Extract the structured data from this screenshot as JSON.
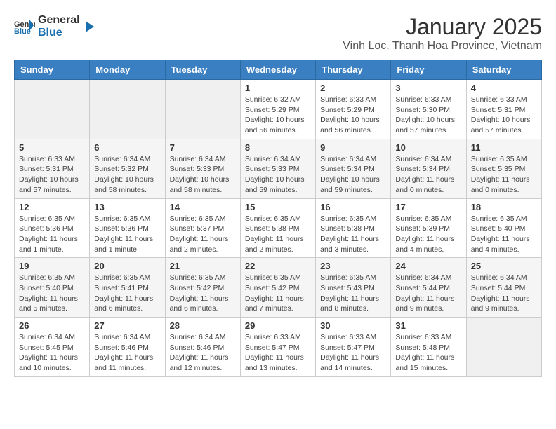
{
  "header": {
    "logo_general": "General",
    "logo_blue": "Blue",
    "month_title": "January 2025",
    "subtitle": "Vinh Loc, Thanh Hoa Province, Vietnam"
  },
  "weekdays": [
    "Sunday",
    "Monday",
    "Tuesday",
    "Wednesday",
    "Thursday",
    "Friday",
    "Saturday"
  ],
  "weeks": [
    [
      {
        "day": "",
        "info": ""
      },
      {
        "day": "",
        "info": ""
      },
      {
        "day": "",
        "info": ""
      },
      {
        "day": "1",
        "info": "Sunrise: 6:32 AM\nSunset: 5:29 PM\nDaylight: 10 hours and 56 minutes."
      },
      {
        "day": "2",
        "info": "Sunrise: 6:33 AM\nSunset: 5:29 PM\nDaylight: 10 hours and 56 minutes."
      },
      {
        "day": "3",
        "info": "Sunrise: 6:33 AM\nSunset: 5:30 PM\nDaylight: 10 hours and 57 minutes."
      },
      {
        "day": "4",
        "info": "Sunrise: 6:33 AM\nSunset: 5:31 PM\nDaylight: 10 hours and 57 minutes."
      }
    ],
    [
      {
        "day": "5",
        "info": "Sunrise: 6:33 AM\nSunset: 5:31 PM\nDaylight: 10 hours and 57 minutes."
      },
      {
        "day": "6",
        "info": "Sunrise: 6:34 AM\nSunset: 5:32 PM\nDaylight: 10 hours and 58 minutes."
      },
      {
        "day": "7",
        "info": "Sunrise: 6:34 AM\nSunset: 5:33 PM\nDaylight: 10 hours and 58 minutes."
      },
      {
        "day": "8",
        "info": "Sunrise: 6:34 AM\nSunset: 5:33 PM\nDaylight: 10 hours and 59 minutes."
      },
      {
        "day": "9",
        "info": "Sunrise: 6:34 AM\nSunset: 5:34 PM\nDaylight: 10 hours and 59 minutes."
      },
      {
        "day": "10",
        "info": "Sunrise: 6:34 AM\nSunset: 5:34 PM\nDaylight: 11 hours and 0 minutes."
      },
      {
        "day": "11",
        "info": "Sunrise: 6:35 AM\nSunset: 5:35 PM\nDaylight: 11 hours and 0 minutes."
      }
    ],
    [
      {
        "day": "12",
        "info": "Sunrise: 6:35 AM\nSunset: 5:36 PM\nDaylight: 11 hours and 1 minute."
      },
      {
        "day": "13",
        "info": "Sunrise: 6:35 AM\nSunset: 5:36 PM\nDaylight: 11 hours and 1 minute."
      },
      {
        "day": "14",
        "info": "Sunrise: 6:35 AM\nSunset: 5:37 PM\nDaylight: 11 hours and 2 minutes."
      },
      {
        "day": "15",
        "info": "Sunrise: 6:35 AM\nSunset: 5:38 PM\nDaylight: 11 hours and 2 minutes."
      },
      {
        "day": "16",
        "info": "Sunrise: 6:35 AM\nSunset: 5:38 PM\nDaylight: 11 hours and 3 minutes."
      },
      {
        "day": "17",
        "info": "Sunrise: 6:35 AM\nSunset: 5:39 PM\nDaylight: 11 hours and 4 minutes."
      },
      {
        "day": "18",
        "info": "Sunrise: 6:35 AM\nSunset: 5:40 PM\nDaylight: 11 hours and 4 minutes."
      }
    ],
    [
      {
        "day": "19",
        "info": "Sunrise: 6:35 AM\nSunset: 5:40 PM\nDaylight: 11 hours and 5 minutes."
      },
      {
        "day": "20",
        "info": "Sunrise: 6:35 AM\nSunset: 5:41 PM\nDaylight: 11 hours and 6 minutes."
      },
      {
        "day": "21",
        "info": "Sunrise: 6:35 AM\nSunset: 5:42 PM\nDaylight: 11 hours and 6 minutes."
      },
      {
        "day": "22",
        "info": "Sunrise: 6:35 AM\nSunset: 5:42 PM\nDaylight: 11 hours and 7 minutes."
      },
      {
        "day": "23",
        "info": "Sunrise: 6:35 AM\nSunset: 5:43 PM\nDaylight: 11 hours and 8 minutes."
      },
      {
        "day": "24",
        "info": "Sunrise: 6:34 AM\nSunset: 5:44 PM\nDaylight: 11 hours and 9 minutes."
      },
      {
        "day": "25",
        "info": "Sunrise: 6:34 AM\nSunset: 5:44 PM\nDaylight: 11 hours and 9 minutes."
      }
    ],
    [
      {
        "day": "26",
        "info": "Sunrise: 6:34 AM\nSunset: 5:45 PM\nDaylight: 11 hours and 10 minutes."
      },
      {
        "day": "27",
        "info": "Sunrise: 6:34 AM\nSunset: 5:46 PM\nDaylight: 11 hours and 11 minutes."
      },
      {
        "day": "28",
        "info": "Sunrise: 6:34 AM\nSunset: 5:46 PM\nDaylight: 11 hours and 12 minutes."
      },
      {
        "day": "29",
        "info": "Sunrise: 6:33 AM\nSunset: 5:47 PM\nDaylight: 11 hours and 13 minutes."
      },
      {
        "day": "30",
        "info": "Sunrise: 6:33 AM\nSunset: 5:47 PM\nDaylight: 11 hours and 14 minutes."
      },
      {
        "day": "31",
        "info": "Sunrise: 6:33 AM\nSunset: 5:48 PM\nDaylight: 11 hours and 15 minutes."
      },
      {
        "day": "",
        "info": ""
      }
    ]
  ]
}
